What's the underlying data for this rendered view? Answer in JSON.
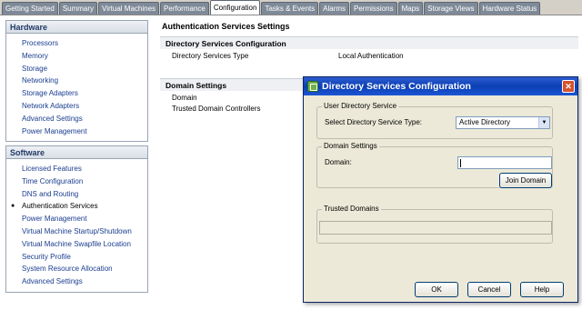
{
  "tabs": [
    "Getting Started",
    "Summary",
    "Virtual Machines",
    "Performance",
    "Configuration",
    "Tasks & Events",
    "Alarms",
    "Permissions",
    "Maps",
    "Storage Views",
    "Hardware Status"
  ],
  "active_tab": "Configuration",
  "hardware": {
    "header": "Hardware",
    "items": [
      "Processors",
      "Memory",
      "Storage",
      "Networking",
      "Storage Adapters",
      "Network Adapters",
      "Advanced Settings",
      "Power Management"
    ]
  },
  "software": {
    "header": "Software",
    "items": [
      "Licensed Features",
      "Time Configuration",
      "DNS and Routing",
      "Authentication Services",
      "Power Management",
      "Virtual Machine Startup/Shutdown",
      "Virtual Machine Swapfile Location",
      "Security Profile",
      "System Resource Allocation",
      "Advanced Settings"
    ],
    "selected": "Authentication Services"
  },
  "main": {
    "title": "Authentication Services Settings",
    "directory_section": "Directory Services Configuration",
    "directory_type_label": "Directory Services Type",
    "directory_type_value": "Local Authentication",
    "domain_section": "Domain Settings",
    "domain_label": "Domain",
    "trusted_label": "Trusted Domain Controllers"
  },
  "dialog": {
    "title": "Directory Services Configuration",
    "user_directory_group": "User Directory Service",
    "select_type_label": "Select Directory Service Type:",
    "select_type_value": "Active Directory",
    "domain_settings_group": "Domain Settings",
    "domain_label": "Domain:",
    "domain_value": "",
    "join_button": "Join Domain",
    "trusted_group": "Trusted Domains",
    "ok_button": "OK",
    "cancel_button": "Cancel",
    "help_button": "Help"
  },
  "icons": {
    "close": "close-icon",
    "dialog": "directory-services-icon",
    "dropdown": "chevron-down-icon",
    "selected_bullet": "bullet-icon"
  }
}
